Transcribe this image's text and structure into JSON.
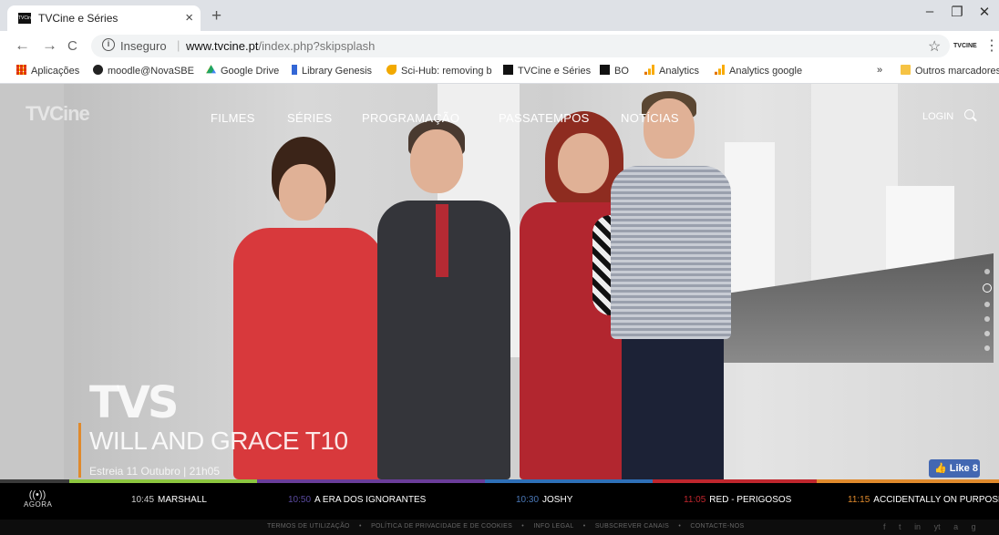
{
  "browser": {
    "tab_title": "TVCine e Séries",
    "tab_favicon": "TVCine",
    "tab_close": "×",
    "new_tab": "+",
    "window_controls": {
      "minimize": "–",
      "restore": "❐",
      "close": "✕"
    },
    "nav": {
      "back": "←",
      "forward": "→",
      "reload": "C"
    },
    "address": {
      "security_label": "Inseguro",
      "separator": "|",
      "domain": "www.tvcine.pt",
      "path": "/index.php?skipsplash"
    },
    "extension_label": "TVCINE",
    "bookmarks": [
      {
        "label": "Aplicações",
        "icon": "apps-grid-icon",
        "color": "#e44a3a"
      },
      {
        "label": "moodle@NovaSBE",
        "icon": "user-icon",
        "color": "#222222"
      },
      {
        "label": "Google Drive",
        "icon": "drive-icon",
        "color": "#1fa463"
      },
      {
        "label": "Library Genesis",
        "icon": "library-icon",
        "color": "#3367d6"
      },
      {
        "label": "Sci-Hub: removing b",
        "icon": "scihub-icon",
        "color": "#f2a900"
      },
      {
        "label": "TVCine e Séries",
        "icon": "tvcine-icon",
        "color": "#111111"
      },
      {
        "label": "BO",
        "icon": "tvcine-icon",
        "color": "#111111"
      },
      {
        "label": "Analytics",
        "icon": "analytics-icon",
        "color": "#f9ab00"
      },
      {
        "label": "Analytics google",
        "icon": "analytics-icon",
        "color": "#f9ab00"
      }
    ],
    "bookmarks_overflow": "»",
    "other_bookmarks": "Outros marcadores"
  },
  "site": {
    "logo": "TVCine",
    "nav": [
      "FILMES",
      "SÉRIES",
      "PROGRAMAÇÃO",
      "PASSATEMPOS",
      "NOTÍCIAS"
    ],
    "login": "LOGIN",
    "hero": {
      "channel_logo": "TVS",
      "title": "WILL AND GRACE T10",
      "subtitle": "Estreia 11 Outubro | 21h05",
      "facebook_like": "Like 8"
    },
    "slides": {
      "count": 6,
      "active_index": 1
    },
    "now_label": "AGORA",
    "schedule_colors": [
      "#3a3a3a",
      "#8cc63f",
      "#6a3d9a",
      "#2e6fb7",
      "#c0262d",
      "#e08a2c"
    ],
    "schedule": [
      {
        "time": "10:45",
        "title": "MARSHALL",
        "time_color": "#cccccc"
      },
      {
        "time": "10:50",
        "title": "A ERA DOS IGNORANTES",
        "time_color": "#5a4aa0"
      },
      {
        "time": "10:30",
        "title": "JOSHY",
        "time_color": "#4a78b8"
      },
      {
        "time": "11:05",
        "title": "RED - PERIGOSOS",
        "time_color": "#c0262d"
      },
      {
        "time": "11:15",
        "title": "ACCIDENTALLY ON PURPOSE",
        "time_color": "#e08a2c"
      }
    ],
    "footer_links": [
      "TERMOS DE UTILIZAÇÃO",
      "•",
      "POLÍTICA DE PRIVACIDADE E DE COOKIES",
      "•",
      "INFO LEGAL",
      "•",
      "SUBSCREVER CANAIS",
      "•",
      "CONTACTE-NOS"
    ],
    "social": [
      "f",
      "t",
      "in",
      "yt",
      "a",
      "g"
    ]
  }
}
